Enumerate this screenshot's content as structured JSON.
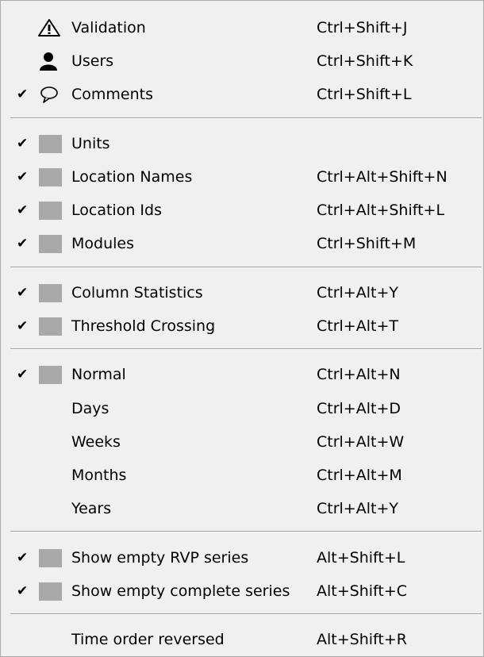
{
  "menu": {
    "items": [
      {
        "label": "Validation",
        "shortcut": "Ctrl+Shift+J",
        "checked": false,
        "icon": "warning-triangle-icon"
      },
      {
        "label": "Users",
        "shortcut": "Ctrl+Shift+K",
        "checked": false,
        "icon": "user-icon"
      },
      {
        "label": "Comments",
        "shortcut": "Ctrl+Shift+L",
        "checked": true,
        "icon": "speech-bubble-icon"
      },
      {
        "label": "Units",
        "shortcut": "",
        "checked": true,
        "icon": "gray-square-icon"
      },
      {
        "label": "Location Names",
        "shortcut": "Ctrl+Alt+Shift+N",
        "checked": true,
        "icon": "gray-square-icon"
      },
      {
        "label": "Location Ids",
        "shortcut": "Ctrl+Alt+Shift+L",
        "checked": true,
        "icon": "gray-square-icon"
      },
      {
        "label": "Modules",
        "shortcut": "Ctrl+Shift+M",
        "checked": true,
        "icon": "gray-square-icon"
      },
      {
        "label": "Column Statistics",
        "shortcut": "Ctrl+Alt+Y",
        "checked": true,
        "icon": "gray-square-icon"
      },
      {
        "label": "Threshold Crossing",
        "shortcut": "Ctrl+Alt+T",
        "checked": true,
        "icon": "gray-square-icon"
      },
      {
        "label": "Normal",
        "shortcut": "Ctrl+Alt+N",
        "checked": true,
        "icon": "gray-square-icon"
      },
      {
        "label": "Days",
        "shortcut": "Ctrl+Alt+D",
        "checked": false,
        "icon": ""
      },
      {
        "label": "Weeks",
        "shortcut": "Ctrl+Alt+W",
        "checked": false,
        "icon": ""
      },
      {
        "label": "Months",
        "shortcut": "Ctrl+Alt+M",
        "checked": false,
        "icon": ""
      },
      {
        "label": "Years",
        "shortcut": "Ctrl+Alt+Y",
        "checked": false,
        "icon": ""
      },
      {
        "label": "Show empty RVP series",
        "shortcut": "Alt+Shift+L",
        "checked": true,
        "icon": "gray-square-icon"
      },
      {
        "label": "Show empty complete series",
        "shortcut": "Alt+Shift+C",
        "checked": true,
        "icon": "gray-square-icon"
      },
      {
        "label": "Time order reversed",
        "shortcut": "Alt+Shift+R",
        "checked": false,
        "icon": ""
      }
    ],
    "check_glyph": "✔"
  }
}
